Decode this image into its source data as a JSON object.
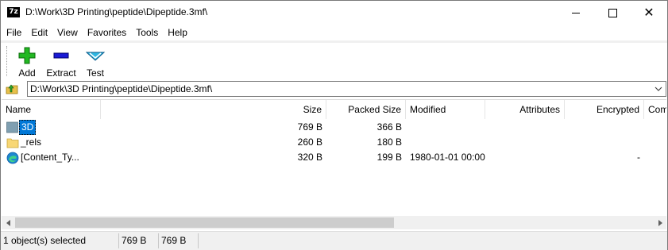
{
  "window": {
    "title": "D:\\Work\\3D Printing\\peptide\\Dipeptide.3mf\\",
    "app_icon_text": "7z"
  },
  "menu": [
    "File",
    "Edit",
    "View",
    "Favorites",
    "Tools",
    "Help"
  ],
  "toolbar": {
    "add_label": "Add",
    "extract_label": "Extract",
    "test_label": "Test",
    "colors": {
      "add": "#22b822",
      "extract": "#1a1ad6",
      "test": "#2fb6e0"
    }
  },
  "address": {
    "path": "D:\\Work\\3D Printing\\peptide\\Dipeptide.3mf\\"
  },
  "columns": [
    "Name",
    "Size",
    "Packed Size",
    "Modified",
    "Attributes",
    "Encrypted",
    "Comment"
  ],
  "rows": [
    {
      "name": "3D",
      "size": "769 B",
      "packed": "366 B",
      "modified": "",
      "attributes": "",
      "encrypted": "",
      "icon": "folder-dark-icon",
      "selected": true
    },
    {
      "name": "_rels",
      "size": "260 B",
      "packed": "180 B",
      "modified": "",
      "attributes": "",
      "encrypted": "",
      "icon": "folder-icon",
      "selected": false
    },
    {
      "name": "[Content_Ty...",
      "size": "320 B",
      "packed": "199 B",
      "modified": "1980-01-01 00:00",
      "attributes": "",
      "encrypted": "-",
      "icon": "edge-browser-icon",
      "selected": false
    }
  ],
  "status": {
    "selection": "1 object(s) selected",
    "size": "769 B",
    "packed": "769 B"
  }
}
